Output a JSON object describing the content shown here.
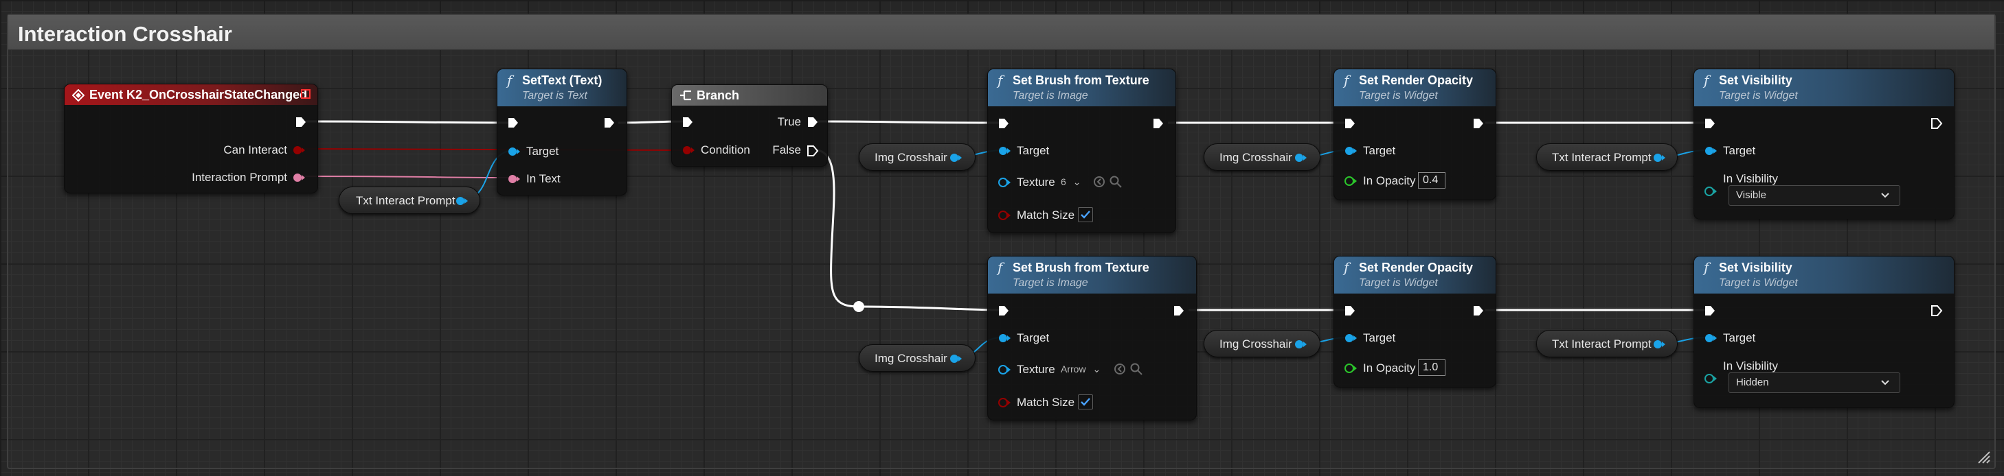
{
  "comment": {
    "title": "Interaction Crosshair"
  },
  "colors": {
    "exec": "#ffffff",
    "object_pin": "#1aa3e8",
    "bool_pin": "#950000",
    "text_pin": "#e07fa6",
    "float_pin": "#2bc62b",
    "event_header": "#a4161a",
    "function_header": "#3a6a93"
  },
  "event_node": {
    "title": "Event K2_OnCrosshairStateChanged",
    "icon": "event-diamond-icon",
    "outputs": [
      "Can Interact",
      "Interaction Prompt"
    ]
  },
  "settext_node": {
    "title": "SetText (Text)",
    "subtitle": "Target is Text",
    "inputs": [
      "Target",
      "In Text"
    ]
  },
  "branch_node": {
    "title": "Branch",
    "icon": "branch-icon",
    "condition": "Condition",
    "true_label": "True",
    "false_label": "False"
  },
  "variables": {
    "txt_interact_prompt": "Txt Interact Prompt",
    "img_crosshair": "Img Crosshair"
  },
  "top_row": {
    "brush": {
      "title": "Set Brush from Texture",
      "subtitle": "Target is Image",
      "target": "Target",
      "texture_label": "Texture",
      "texture_value": "6",
      "match_size": "Match Size",
      "match_checked": true
    },
    "opacity": {
      "title": "Set Render Opacity",
      "subtitle": "Target is Widget",
      "target": "Target",
      "opacity_label": "In Opacity",
      "opacity_value": "0.4"
    },
    "visibility": {
      "title": "Set Visibility",
      "subtitle": "Target is Widget",
      "target": "Target",
      "vis_label": "In Visibility",
      "vis_value": "Visible"
    }
  },
  "bottom_row": {
    "brush": {
      "title": "Set Brush from Texture",
      "subtitle": "Target is Image",
      "target": "Target",
      "texture_label": "Texture",
      "texture_value": "Arrow",
      "match_size": "Match Size",
      "match_checked": true
    },
    "opacity": {
      "title": "Set Render Opacity",
      "subtitle": "Target is Widget",
      "target": "Target",
      "opacity_label": "In Opacity",
      "opacity_value": "1.0"
    },
    "visibility": {
      "title": "Set Visibility",
      "subtitle": "Target is Widget",
      "target": "Target",
      "vis_label": "In Visibility",
      "vis_value": "Hidden"
    }
  }
}
